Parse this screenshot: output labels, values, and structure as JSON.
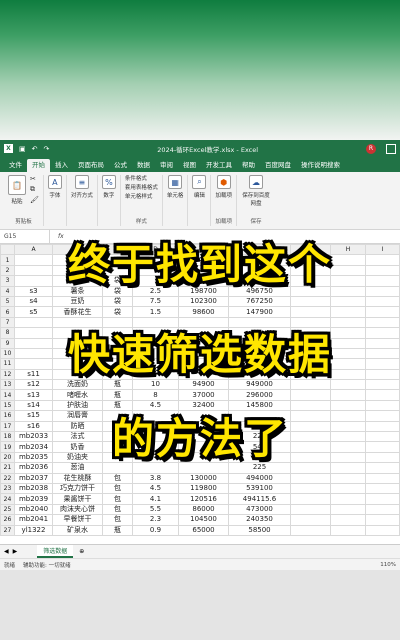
{
  "window": {
    "title": "2024-循环Excel教学.xlsx - Excel",
    "account_initial": "R"
  },
  "ribbon_tabs": [
    "文件",
    "开始",
    "插入",
    "页面布局",
    "公式",
    "数据",
    "审阅",
    "视图",
    "开发工具",
    "帮助",
    "百度网盘",
    "操作说明搜索"
  ],
  "ribbon": {
    "paste": "粘贴",
    "clipboard_group": "剪贴板",
    "font": "字体",
    "align": "对齐方式",
    "number": "数字",
    "cond_format": "条件格式",
    "table_format": "套用表格格式",
    "cell_style": "单元格样式",
    "style_group": "样式",
    "cells": "单元格",
    "edit": "编辑",
    "addin": "加载项",
    "addin_group": "加载项",
    "save_baidu": "保存到百度网盘",
    "save_group": "保存"
  },
  "formula": {
    "namebox": "G15",
    "fx": "fx"
  },
  "columns": [
    "A",
    "B",
    "C",
    "D",
    "E",
    "F",
    "G",
    "H",
    "I"
  ],
  "rows": [
    {
      "n": "1",
      "a": "",
      "b": "",
      "c": "",
      "d": "",
      "e": "",
      "f": ""
    },
    {
      "n": "2",
      "a": "",
      "b": "辣萝卜",
      "c": "",
      "d": "",
      "e": "",
      "f": ""
    },
    {
      "n": "3",
      "a": "",
      "b": "虾片",
      "c": "袋",
      "d": "",
      "e": "",
      "f": ""
    },
    {
      "n": "4",
      "a": "s3",
      "b": "薯条",
      "c": "袋",
      "d": "2.5",
      "e": "198700",
      "f": "496750"
    },
    {
      "n": "5",
      "a": "s4",
      "b": "豆奶",
      "c": "袋",
      "d": "7.5",
      "e": "102300",
      "f": "767250"
    },
    {
      "n": "6",
      "a": "s5",
      "b": "香酥花生",
      "c": "袋",
      "d": "1.5",
      "e": "98600",
      "f": "147900"
    },
    {
      "n": "7",
      "a": "",
      "b": "",
      "c": "",
      "d": "",
      "e": "",
      "f": ""
    },
    {
      "n": "8",
      "a": "",
      "b": "",
      "c": "",
      "d": "",
      "e": "",
      "f": ""
    },
    {
      "n": "9",
      "a": "",
      "b": "",
      "c": "",
      "d": "",
      "e": "",
      "f": ""
    },
    {
      "n": "10",
      "a": "",
      "b": "",
      "c": "",
      "d": "",
      "e": "",
      "f": ""
    },
    {
      "n": "11",
      "a": "",
      "b": "",
      "c": "",
      "d": "",
      "e": "",
      "f": ""
    },
    {
      "n": "12",
      "a": "s11",
      "b": "",
      "c": "",
      "d": "",
      "e": "",
      "f": ""
    },
    {
      "n": "13",
      "a": "s12",
      "b": "洗面奶",
      "c": "瓶",
      "d": "10",
      "e": "94900",
      "f": "949000"
    },
    {
      "n": "14",
      "a": "s13",
      "b": "啫喱水",
      "c": "瓶",
      "d": "8",
      "e": "37000",
      "f": "296000"
    },
    {
      "n": "15",
      "a": "s14",
      "b": "护肤油",
      "c": "瓶",
      "d": "4.5",
      "e": "32400",
      "f": "145800"
    },
    {
      "n": "16",
      "a": "s15",
      "b": "润唇膏",
      "c": "",
      "d": "",
      "e": "",
      "f": ""
    },
    {
      "n": "17",
      "a": "s16",
      "b": "防晒",
      "c": "",
      "d": "",
      "e": "",
      "f": ""
    },
    {
      "n": "18",
      "a": "mb2033",
      "b": "法式",
      "c": "",
      "d": "",
      "e": "",
      "f": "225"
    },
    {
      "n": "19",
      "a": "mb2034",
      "b": "奶香",
      "c": "",
      "d": "",
      "e": "",
      "f": "540"
    },
    {
      "n": "20",
      "a": "mb2035",
      "b": "奶油夹",
      "c": "",
      "d": "",
      "e": "",
      "f": "667"
    },
    {
      "n": "21",
      "a": "mb2036",
      "b": "葱油",
      "c": "",
      "d": "",
      "e": "",
      "f": "225"
    },
    {
      "n": "22",
      "a": "mb2037",
      "b": "花生桃酥",
      "c": "包",
      "d": "3.8",
      "e": "130000",
      "f": "494000"
    },
    {
      "n": "23",
      "a": "mb2038",
      "b": "巧克力饼干",
      "c": "包",
      "d": "4.5",
      "e": "119800",
      "f": "539100"
    },
    {
      "n": "24",
      "a": "mb2039",
      "b": "果酱饼干",
      "c": "包",
      "d": "4.1",
      "e": "120516",
      "f": "494115.6"
    },
    {
      "n": "25",
      "a": "mb2040",
      "b": "肉沫夹心饼",
      "c": "包",
      "d": "5.5",
      "e": "86000",
      "f": "473000"
    },
    {
      "n": "26",
      "a": "mb2041",
      "b": "早餐饼干",
      "c": "包",
      "d": "2.3",
      "e": "104500",
      "f": "240350"
    },
    {
      "n": "27",
      "a": "yl1322",
      "b": "矿泉水",
      "c": "瓶",
      "d": "0.9",
      "e": "65000",
      "f": "58500"
    }
  ],
  "sheet_tab": "筛选数据",
  "status": {
    "ready": "就绪",
    "accessibility": "辅助功能: 一切就绪",
    "zoom": "110%"
  },
  "overlay": {
    "line1": "终于找到这个",
    "line2": "快速筛选数据",
    "line3": "的方法了"
  }
}
